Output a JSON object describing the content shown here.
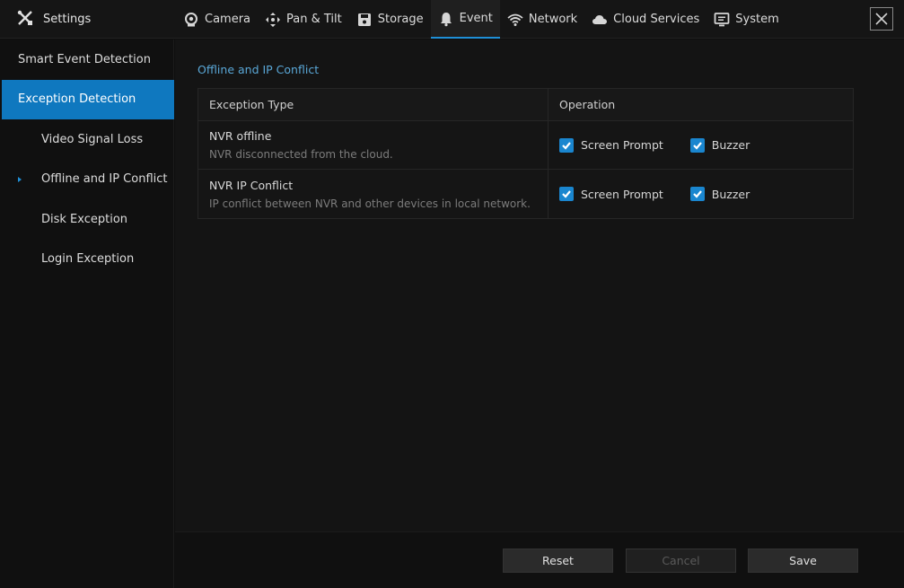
{
  "app": {
    "title": "Settings"
  },
  "tabs": [
    {
      "label": "Camera",
      "icon": "camera-icon"
    },
    {
      "label": "Pan & Tilt",
      "icon": "pan-tilt-icon"
    },
    {
      "label": "Storage",
      "icon": "storage-icon"
    },
    {
      "label": "Event",
      "icon": "bell-icon",
      "active": true
    },
    {
      "label": "Network",
      "icon": "wifi-icon"
    },
    {
      "label": "Cloud Services",
      "icon": "cloud-icon"
    },
    {
      "label": "System",
      "icon": "monitor-icon"
    }
  ],
  "sidebar": {
    "items": [
      {
        "label": "Smart Event Detection"
      },
      {
        "label": "Exception Detection",
        "active": true
      },
      {
        "label": "Video Signal Loss"
      },
      {
        "label": "Offline and IP Conflict",
        "current": true
      },
      {
        "label": "Disk Exception"
      },
      {
        "label": "Login Exception"
      }
    ]
  },
  "main": {
    "section_title": "Offline and IP Conflict",
    "table": {
      "headers": [
        "Exception Type",
        "Operation"
      ],
      "rows": [
        {
          "name": "NVR offline",
          "desc": "NVR disconnected from the cloud.",
          "screen_prompt": "Screen Prompt",
          "buzzer": "Buzzer"
        },
        {
          "name": "NVR IP Conflict",
          "desc": "IP conflict between NVR and other devices in local network.",
          "screen_prompt": "Screen Prompt",
          "buzzer": "Buzzer"
        }
      ]
    }
  },
  "footer": {
    "reset": "Reset",
    "cancel": "Cancel",
    "save": "Save"
  },
  "colors": {
    "accent": "#1f8fd6",
    "active_bg": "#0f78bf",
    "section_title": "#5aa8d8"
  }
}
